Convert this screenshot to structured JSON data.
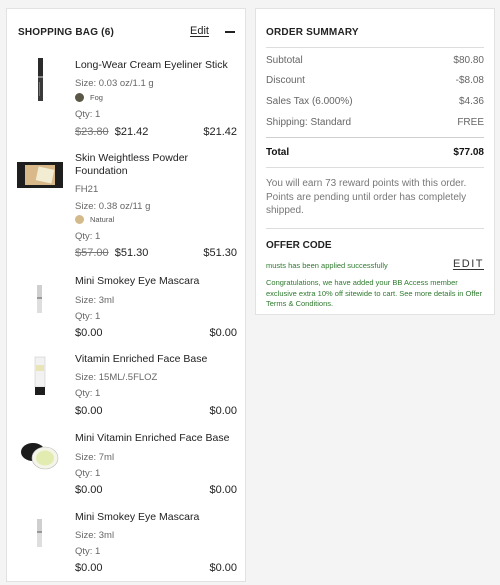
{
  "bag": {
    "title": "SHOPPING BAG (6)",
    "edit_label": "Edit",
    "items": [
      {
        "name": "Long-Wear Cream Eyeliner Stick",
        "size": "Size: 0.03 oz/1.1 g",
        "shade": "Fog",
        "shade_color": "#5a5648",
        "qty": "Qty: 1",
        "orig_price": "$23.80",
        "price": "$21.42",
        "total": "$21.42"
      },
      {
        "name": "Skin Weightless Powder Foundation",
        "code": "FH21",
        "size": "Size: 0.38 oz/11 g",
        "shade": "Natural",
        "shade_color": "#d4b98a",
        "qty": "Qty: 1",
        "orig_price": "$57.00",
        "price": "$51.30",
        "total": "$51.30"
      },
      {
        "name": "Mini Smokey Eye Mascara",
        "size": "Size: 3ml",
        "qty": "Qty: 1",
        "price": "$0.00",
        "total": "$0.00"
      },
      {
        "name": "Vitamin Enriched Face Base",
        "size": "Size: 15ML/.5FLOZ",
        "qty": "Qty: 1",
        "price": "$0.00",
        "total": "$0.00"
      },
      {
        "name": "Mini Vitamin Enriched Face Base",
        "size": "Size: 7ml",
        "qty": "Qty: 1",
        "price": "$0.00",
        "total": "$0.00"
      },
      {
        "name": "Mini Smokey Eye Mascara",
        "size": "Size: 3ml",
        "qty": "Qty: 1",
        "price": "$0.00",
        "total": "$0.00"
      }
    ]
  },
  "summary": {
    "title": "ORDER SUMMARY",
    "subtotal_label": "Subtotal",
    "subtotal": "$80.80",
    "discount_label": "Discount",
    "discount": "-$8.08",
    "tax_label": "Sales Tax (6.000%)",
    "tax": "$4.36",
    "shipping_label": "Shipping: Standard",
    "shipping": "FREE",
    "total_label": "Total",
    "total": "$77.08",
    "rewards_text": "You will earn 73 reward points with this order. Points are pending until order has completely shipped.",
    "offer_title": "OFFER CODE",
    "offer_msg": "musts has been applied successfully",
    "offer_edit": "EDIT",
    "offer_congrats": "Congratulations, we have added your BB Access member exclusive extra 10% off sitewide to cart. See more details in Offer Terms & Conditions."
  }
}
